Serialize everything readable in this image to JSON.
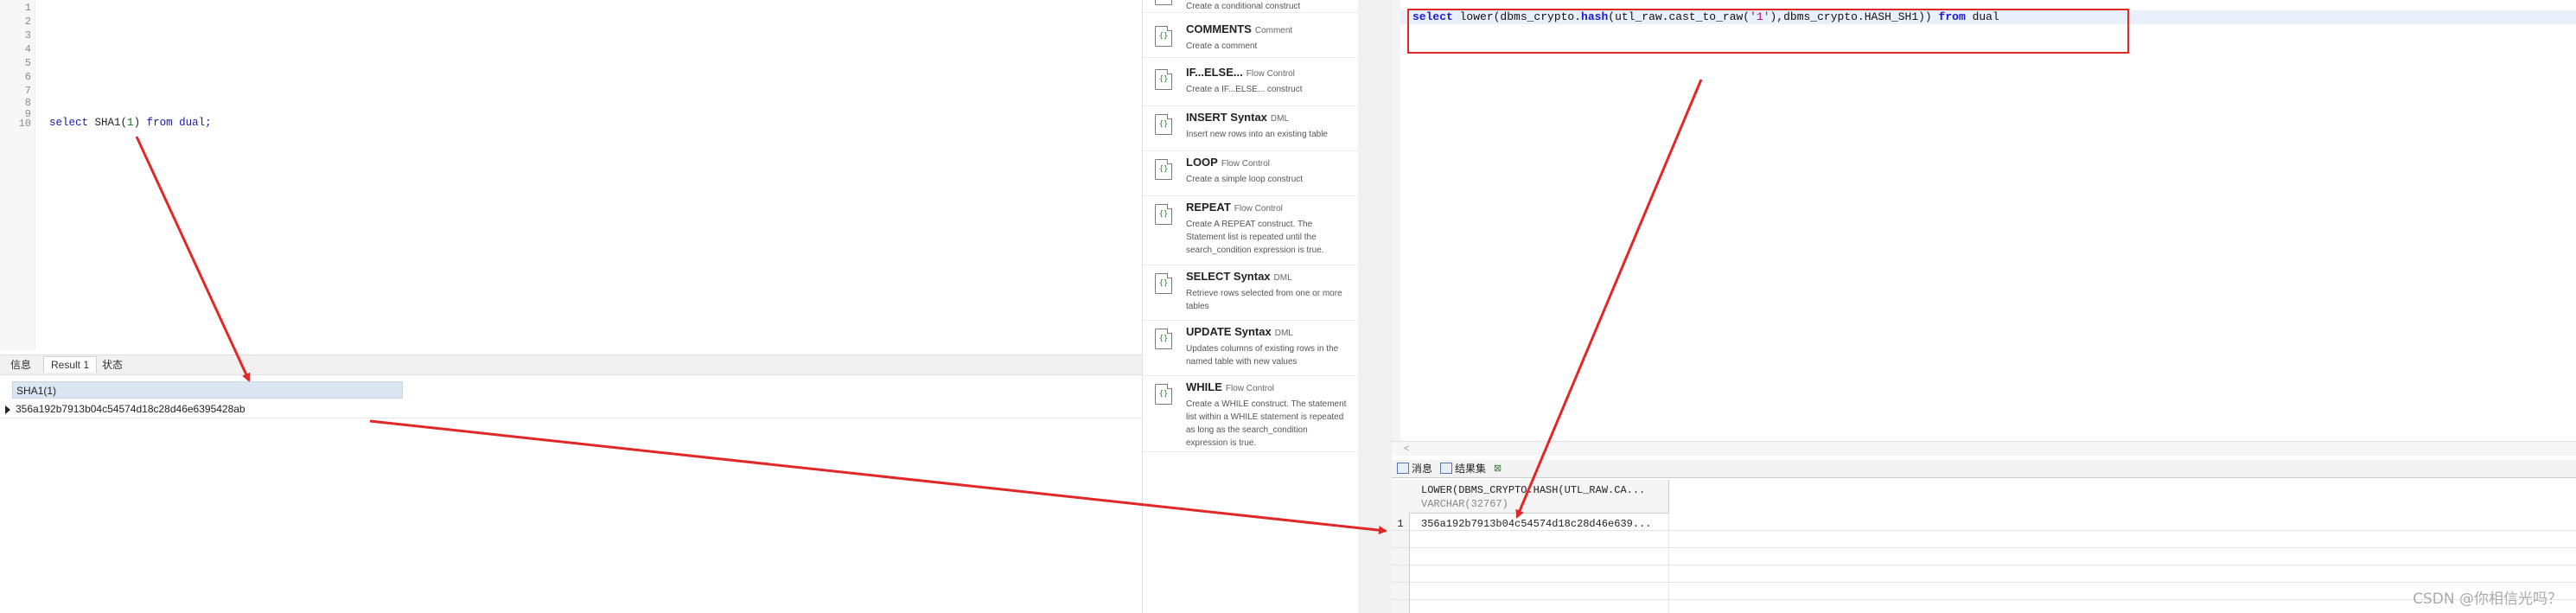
{
  "left_editor": {
    "line_numbers": [
      "1",
      "2",
      "3",
      "4",
      "5",
      "6",
      "7",
      "8",
      "9",
      "10"
    ],
    "code": {
      "kw_select": "select",
      "func": "SHA1(",
      "arg": "1",
      "close": ")",
      "kw_from": "from",
      "table": "dual;"
    },
    "tabs": [
      "信息",
      "Result 1",
      "状态"
    ],
    "result": {
      "column_header": "SHA1(1)",
      "row_value": "356a192b7913b04c54574d18c28d46e6395428ab"
    }
  },
  "snippets": [
    {
      "title": "",
      "category": "",
      "desc": "Create a conditional construct"
    },
    {
      "title": "COMMENTS",
      "category": "Comment",
      "desc": "Create a comment"
    },
    {
      "title": "IF...ELSE...",
      "category": "Flow Control",
      "desc": "Create a IF...ELSE... construct"
    },
    {
      "title": "INSERT Syntax",
      "category": "DML",
      "desc": "Insert new rows into an existing table"
    },
    {
      "title": "LOOP",
      "category": "Flow Control",
      "desc": "Create a simple loop construct"
    },
    {
      "title": "REPEAT",
      "category": "Flow Control",
      "desc": "Create A REPEAT construct. The Statement list is repeated until the search_condition expression is true."
    },
    {
      "title": "SELECT Syntax",
      "category": "DML",
      "desc": "Retrieve rows selected from one or more tables"
    },
    {
      "title": "UPDATE Syntax",
      "category": "DML",
      "desc": "Updates columns of existing rows in the named table with new values"
    },
    {
      "title": "WHILE",
      "category": "Flow Control",
      "desc": "Create a WHILE construct. The statement list within a WHILE statement is repeated as long as the search_condition expression is true."
    }
  ],
  "snippet_icon": "snippet-file-icon",
  "right_editor": {
    "code": {
      "kw_select": "select",
      "p1": " lower(dbms_crypto.",
      "kw_hash": "hash",
      "p2": "(utl_raw.cast_to_raw(",
      "str": "'1'",
      "p3": "),dbms_crypto.HASH_SH1)) ",
      "kw_from": "from",
      "p4": " dual"
    },
    "scroll_arrow": "<",
    "tabs": [
      "消息",
      "结果集"
    ],
    "tab_close": "⊠",
    "result": {
      "column_name": "LOWER(DBMS_CRYPTO.HASH(UTL_RAW.CA...",
      "column_type": "VARCHAR(32767)",
      "row_number": "1",
      "row_value": "356a192b7913b04c54574d18c28d46e639..."
    }
  },
  "watermark": "CSDN @你相信光吗？",
  "colors": {
    "annotation_red": "#e02828",
    "keyword_blue": "#1a1aa6",
    "header_blue": "#dce6f2"
  }
}
